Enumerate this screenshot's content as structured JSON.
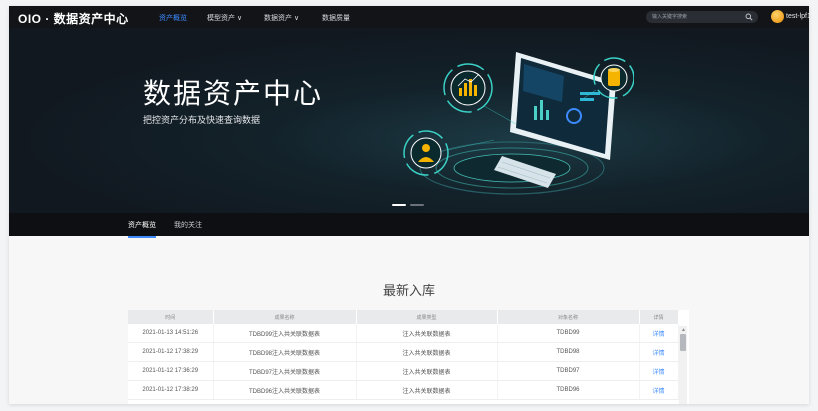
{
  "header": {
    "logo": "OIO · 数据资产中心",
    "menu": [
      {
        "label": "资产概览",
        "active": true
      },
      {
        "label": "模型资产 ∨",
        "active": false
      },
      {
        "label": "数据资产 ∨",
        "active": false
      },
      {
        "label": "数据质量",
        "active": false
      }
    ],
    "search_placeholder": "输入关键字搜索",
    "username": "test-lpf1"
  },
  "banner": {
    "title": "数据资产中心",
    "subtitle": "把控资产分布及快速查询数据"
  },
  "tabs": [
    {
      "label": "资产概览",
      "active": true
    },
    {
      "label": "我的关注",
      "active": false
    }
  ],
  "section": {
    "title": "最新入库",
    "columns": [
      "时间",
      "成果名称",
      "成果类型",
      "对象名称",
      "详情"
    ],
    "rows": [
      [
        "2021-01-13 14:51:26",
        "TDBD99注入共关联数据表",
        "注入共关联数据表",
        "TDBD99",
        "详情"
      ],
      [
        "2021-01-12 17:38:29",
        "TDBD98注入共关联数据表",
        "注入共关联数据表",
        "TDBD98",
        "详情"
      ],
      [
        "2021-01-12 17:36:29",
        "TDBD97注入共关联数据表",
        "注入共关联数据表",
        "TDBD97",
        "详情"
      ],
      [
        "2021-01-12 17:38:29",
        "TDBD96注入共关联数据表",
        "注入共关联数据表",
        "TDBD96",
        "详情"
      ]
    ]
  },
  "colors": {
    "accent": "#3d8bff",
    "nav_bg": "#121418",
    "banner_bg": "#111820",
    "tab_bg": "#0e0f12"
  },
  "icons": [
    "search-icon",
    "avatar",
    "chart-icon",
    "database-icon",
    "user-icon",
    "monitor-illustration"
  ]
}
